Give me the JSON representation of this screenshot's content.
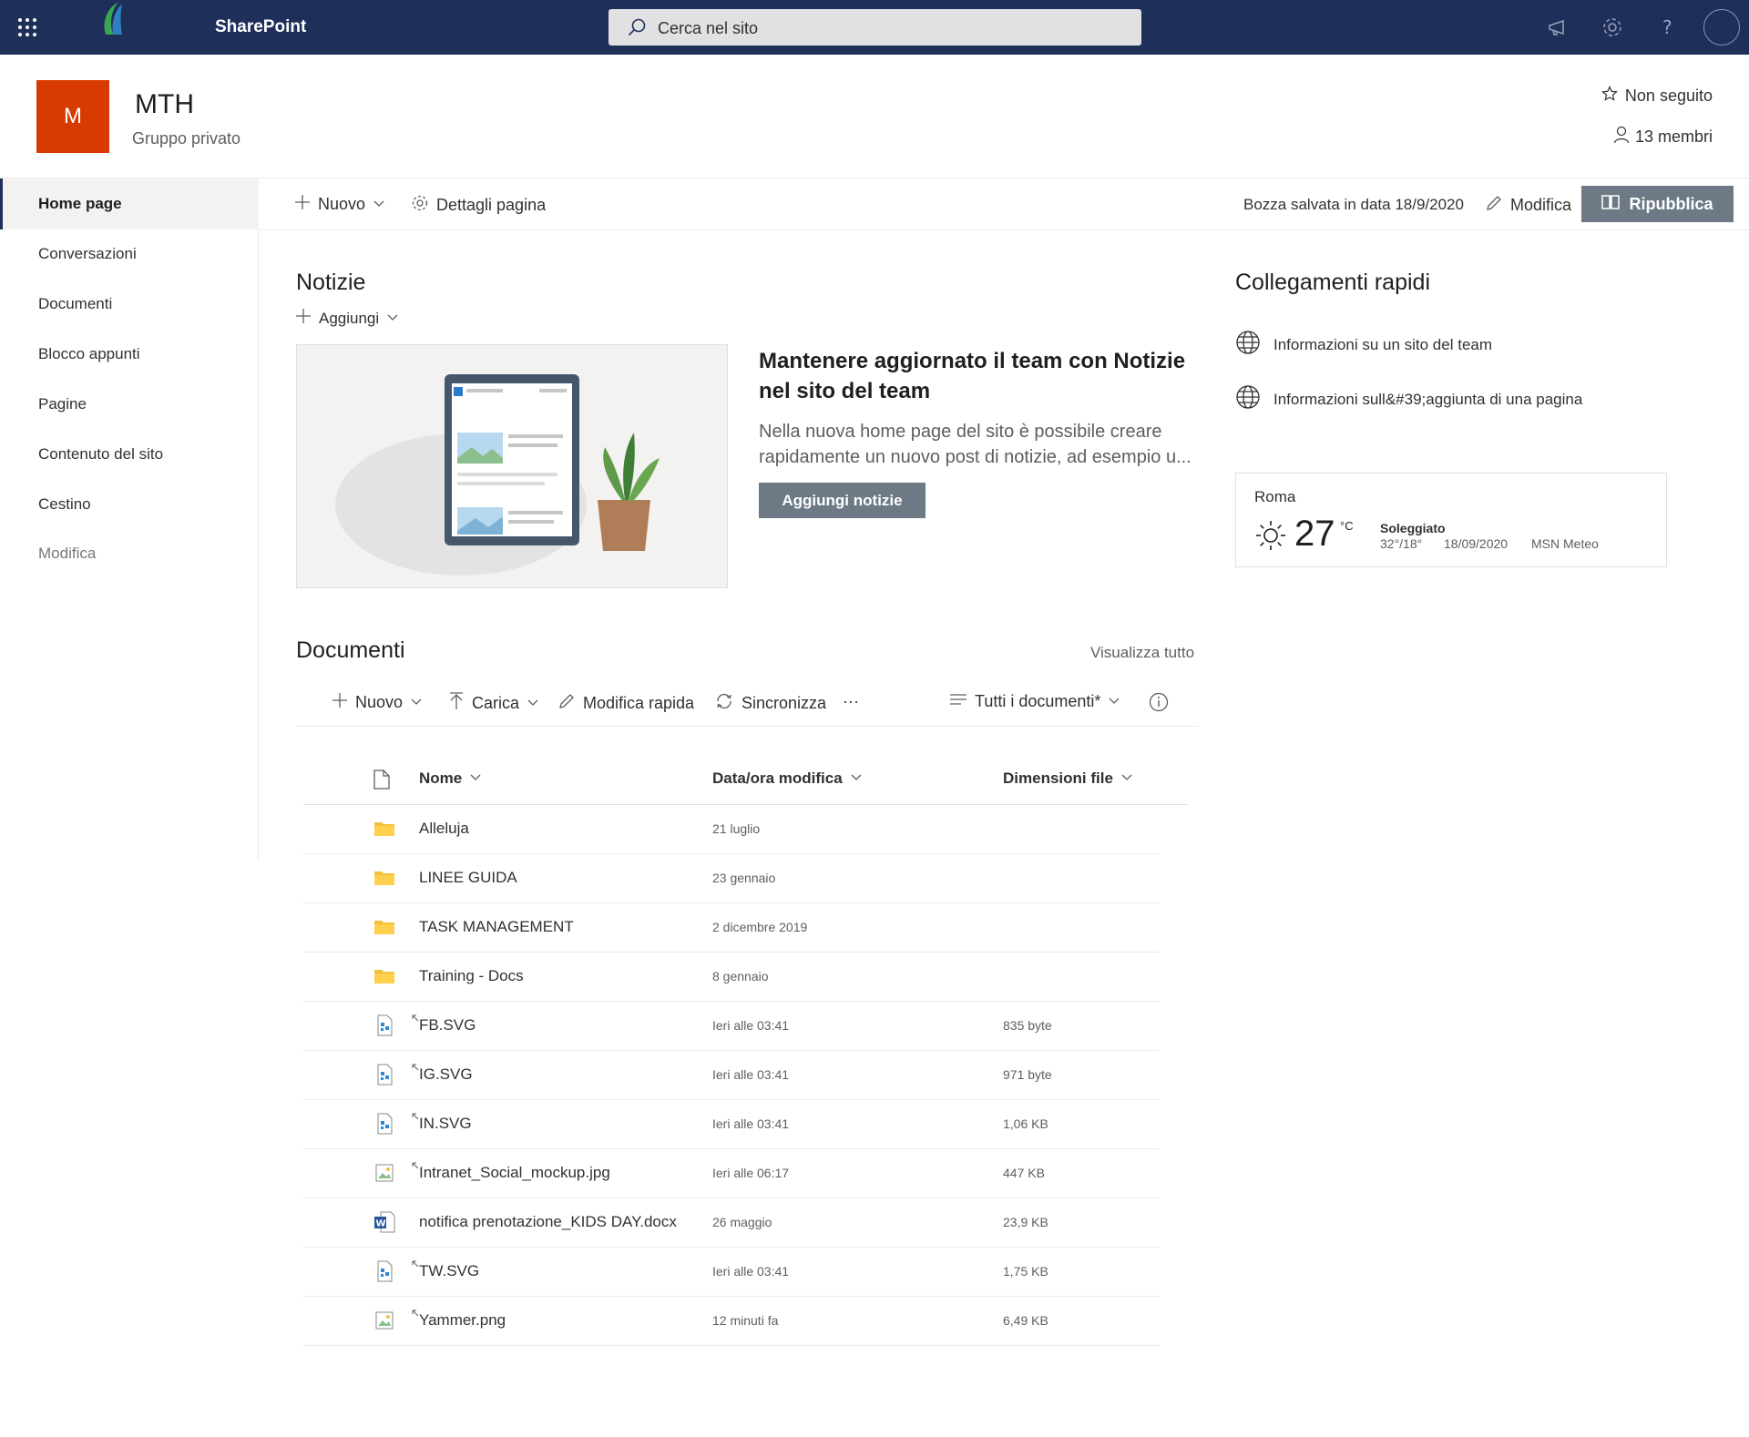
{
  "suite": {
    "brand": "SharePoint",
    "search_placeholder": "Cerca nel sito"
  },
  "site": {
    "logo_letter": "M",
    "title": "MTH",
    "subtitle": "Gruppo privato",
    "follow_label": "Non seguito",
    "members_label": "13 membri"
  },
  "nav": {
    "items": [
      {
        "label": "Home page"
      },
      {
        "label": "Conversazioni"
      },
      {
        "label": "Documenti"
      },
      {
        "label": "Blocco appunti"
      },
      {
        "label": "Pagine"
      },
      {
        "label": "Contenuto del sito"
      },
      {
        "label": "Cestino"
      },
      {
        "label": "Modifica"
      }
    ]
  },
  "commandbar": {
    "new_label": "Nuovo",
    "details_label": "Dettagli pagina",
    "draft_status": "Bozza salvata in data 18/9/2020",
    "edit_label": "Modifica",
    "republish_label": "Ripubblica"
  },
  "news": {
    "heading": "Notizie",
    "add_label": "Aggiungi",
    "title": "Mantenere aggiornato il team con Notizie nel sito del team",
    "description": "Nella nuova home page del sito è possibile creare rapidamente un nuovo post di notizie, ad esempio u...",
    "button_label": "Aggiungi notizie"
  },
  "quicklinks": {
    "heading": "Collegamenti rapidi",
    "items": [
      {
        "label": "Informazioni su un sito del team"
      },
      {
        "label": "Informazioni sull&#39;aggiunta di una pagina"
      }
    ]
  },
  "weather": {
    "city": "Roma",
    "temperature": "27",
    "unit": "°C",
    "condition": "Soleggiato",
    "range": "32°/18°",
    "date": "18/09/2020",
    "provider": "MSN Meteo"
  },
  "documents": {
    "heading": "Documenti",
    "view_all": "Visualizza tutto",
    "toolbar": {
      "new": "Nuovo",
      "upload": "Carica",
      "quick_edit": "Modifica rapida",
      "sync": "Sincronizza",
      "more": "···",
      "view": "Tutti i documenti*"
    },
    "columns": {
      "name": "Nome",
      "modified": "Data/ora modifica",
      "size": "Dimensioni file"
    },
    "rows": [
      {
        "type": "folder",
        "name": "Alleluja",
        "modified": "21 luglio",
        "size": ""
      },
      {
        "type": "folder",
        "name": "LINEE GUIDA",
        "modified": "23 gennaio",
        "size": ""
      },
      {
        "type": "folder",
        "name": "TASK MANAGEMENT",
        "modified": "2 dicembre 2019",
        "size": ""
      },
      {
        "type": "folder",
        "name": "Training - Docs",
        "modified": "8 gennaio",
        "size": ""
      },
      {
        "type": "svg",
        "name": "FB.SVG",
        "modified": "Ieri alle 03:41",
        "size": "835 byte"
      },
      {
        "type": "svg",
        "name": "IG.SVG",
        "modified": "Ieri alle 03:41",
        "size": "971 byte"
      },
      {
        "type": "svg",
        "name": "IN.SVG",
        "modified": "Ieri alle 03:41",
        "size": "1,06 KB"
      },
      {
        "type": "image",
        "name": "Intranet_Social_mockup.jpg",
        "modified": "Ieri alle 06:17",
        "size": "447 KB"
      },
      {
        "type": "word",
        "name": "notifica prenotazione_KIDS DAY.docx",
        "modified": "26 maggio",
        "size": "23,9 KB"
      },
      {
        "type": "svg",
        "name": "TW.SVG",
        "modified": "Ieri alle 03:41",
        "size": "1,75 KB"
      },
      {
        "type": "image",
        "name": "Yammer.png",
        "modified": "12 minuti fa",
        "size": "6,49 KB"
      }
    ]
  },
  "colors": {
    "suite_bar": "#1e2f5a",
    "site_logo": "#d83b01",
    "button": "#6d7a85",
    "folder": "#f4c13d",
    "word": "#2b579a"
  }
}
